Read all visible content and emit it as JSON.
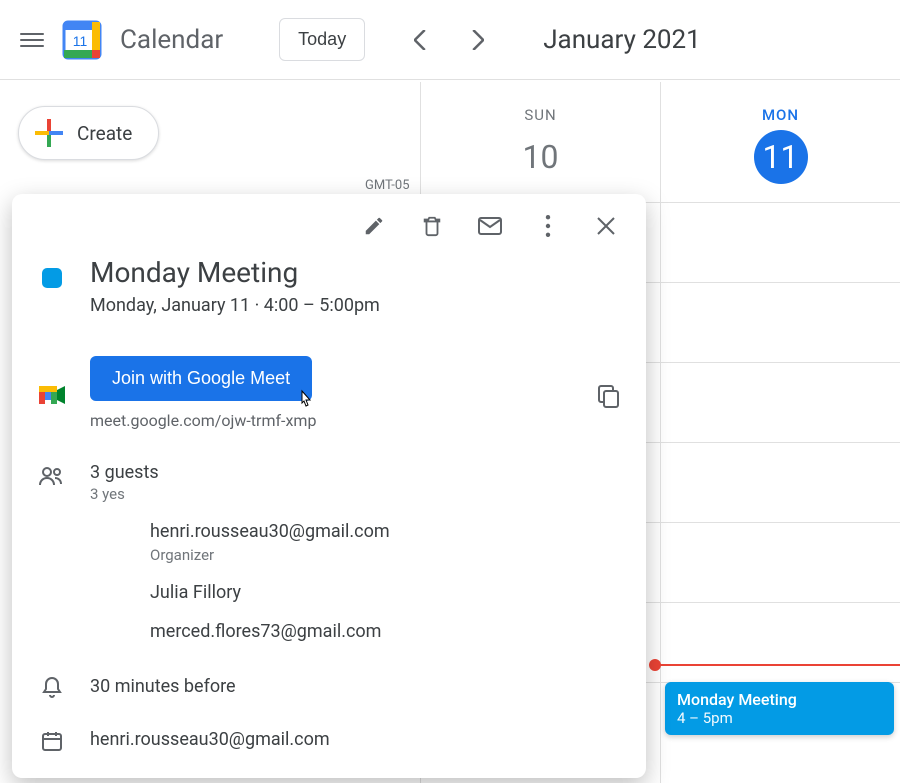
{
  "header": {
    "app_name": "Calendar",
    "today_label": "Today",
    "current_range": "January 2021"
  },
  "create": {
    "label": "Create"
  },
  "timezone": "GMT-05",
  "days": {
    "sun": {
      "dow": "Sun",
      "date": "10"
    },
    "mon": {
      "dow": "Mon",
      "date": "11"
    }
  },
  "grid_event": {
    "title": "Monday Meeting",
    "time": "4 – 5pm"
  },
  "popup": {
    "title": "Monday Meeting",
    "when": "Monday, January 11  ·  4:00 – 5:00pm",
    "meet_button": "Join with Google Meet",
    "meet_link": "meet.google.com/ojw-trmf-xmp",
    "guests_count": "3 guests",
    "guests_yes": "3 yes",
    "guests": [
      {
        "label": "henri.rousseau30@gmail.com",
        "role": "Organizer"
      },
      {
        "label": "Julia Fillory"
      },
      {
        "label": "merced.flores73@gmail.com"
      }
    ],
    "reminder": "30 minutes before",
    "calendar_owner": "henri.rousseau30@gmail.com"
  }
}
